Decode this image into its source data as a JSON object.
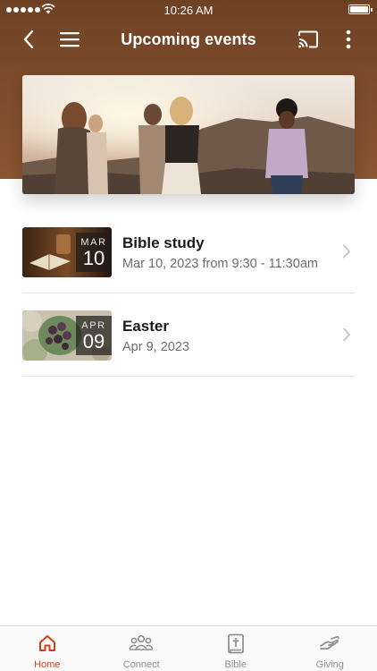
{
  "status_bar": {
    "time": "10:26 AM"
  },
  "nav": {
    "title": "Upcoming events",
    "icons": [
      "back-icon",
      "menu-icon",
      "cast-icon",
      "more-icon"
    ]
  },
  "events": [
    {
      "title": "Bible study",
      "subtitle": "Mar 10, 2023 from 9:30 - 11:30am",
      "month": "MAR",
      "day": "10"
    },
    {
      "title": "Easter",
      "subtitle": "Apr 9, 2023",
      "month": "APR",
      "day": "09"
    }
  ],
  "tabs": [
    {
      "label": "Home",
      "icon": "home-icon",
      "active": true
    },
    {
      "label": "Connect",
      "icon": "people-icon",
      "active": false
    },
    {
      "label": "Bible",
      "icon": "bible-icon",
      "active": false
    },
    {
      "label": "Giving",
      "icon": "giving-hand-icon",
      "active": false
    }
  ],
  "colors": {
    "header": "#7d4b2b",
    "accent": "#c7431b",
    "inactive": "#8e8e8e",
    "subtitle": "#6d6d6d"
  }
}
